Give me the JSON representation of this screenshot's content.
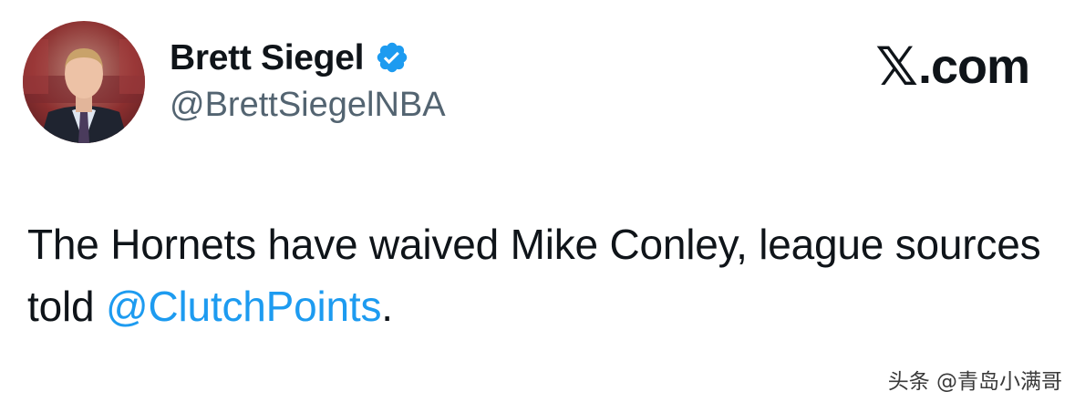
{
  "author": {
    "display_name": "Brett Siegel",
    "handle": "@BrettSiegelNBA",
    "verified": true
  },
  "brand": {
    "label": ".com",
    "logo_letter": "𝕏"
  },
  "tweet": {
    "text_before": "The Hornets have waived Mike Conley, league sources told ",
    "mention": "@ClutchPoints",
    "text_after": "."
  },
  "watermark": {
    "text": "头条 @青岛小满哥"
  },
  "colors": {
    "text": "#0f1419",
    "secondary": "#536471",
    "link": "#1d9bf0",
    "verified_badge": "#1d9bf0"
  },
  "icons": {
    "verified": "verified-badge-icon",
    "avatar": "profile-photo"
  }
}
